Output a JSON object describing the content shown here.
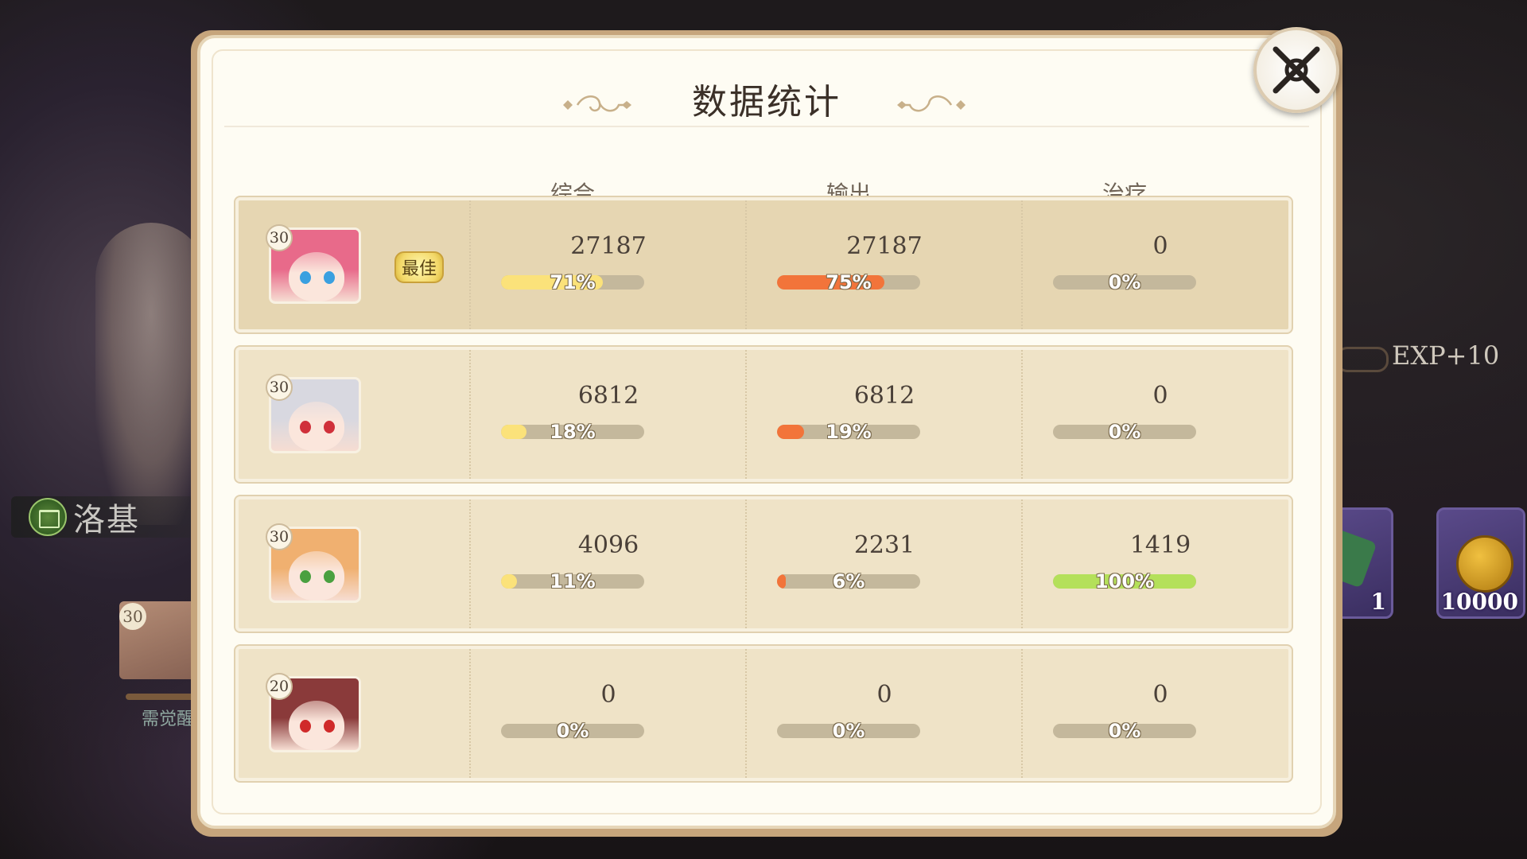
{
  "dialog": {
    "title": "数据统计",
    "columns": [
      "综合",
      "输出",
      "治疗"
    ]
  },
  "rows": [
    {
      "level": "30",
      "best_label": "最佳",
      "avatar": {
        "hair": "#e86a8a",
        "eye": "#3aa0e0"
      },
      "overall": {
        "value": "27187",
        "percent": "71%"
      },
      "damage": {
        "value": "27187",
        "percent": "75%"
      },
      "heal": {
        "value": "0",
        "percent": "0%"
      }
    },
    {
      "level": "30",
      "avatar": {
        "hair": "#d8d8e0",
        "eye": "#d0303a"
      },
      "overall": {
        "value": "6812",
        "percent": "18%"
      },
      "damage": {
        "value": "6812",
        "percent": "19%"
      },
      "heal": {
        "value": "0",
        "percent": "0%"
      }
    },
    {
      "level": "30",
      "avatar": {
        "hair": "#f0b070",
        "eye": "#4aa040"
      },
      "overall": {
        "value": "4096",
        "percent": "11%"
      },
      "damage": {
        "value": "2231",
        "percent": "6%"
      },
      "heal": {
        "value": "1419",
        "percent": "100%"
      }
    },
    {
      "level": "20",
      "avatar": {
        "hair": "#8a3a3a",
        "eye": "#d02a2a"
      },
      "overall": {
        "value": "0",
        "percent": "0%"
      },
      "damage": {
        "value": "0",
        "percent": "0%"
      },
      "heal": {
        "value": "0",
        "percent": "0%"
      }
    }
  ],
  "colors": {
    "overall_bar": "#fbe27a",
    "damage_bar": "#f2743a",
    "heal_bar": "#b4e05a"
  },
  "background": {
    "character_name": "洛基",
    "card_level": "30",
    "card_label": "需觉醒",
    "exp_text": "EXP+10",
    "reward_1_count": "1",
    "reward_2_count": "10000"
  }
}
